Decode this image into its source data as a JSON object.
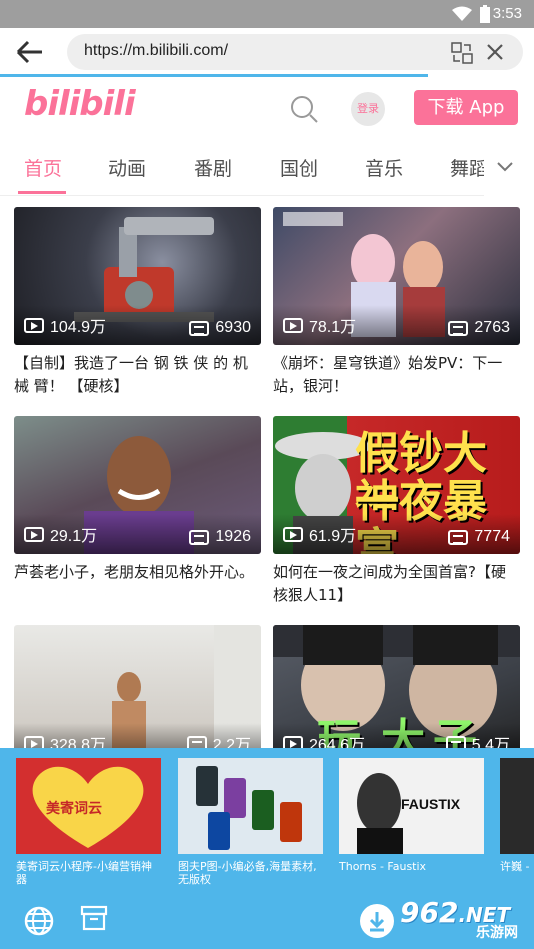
{
  "status": {
    "time": "3:53"
  },
  "browser": {
    "url": "https://m.bilibili.com/"
  },
  "header": {
    "logo": "bilibili",
    "login_label": "登录",
    "download_label": "下载 App"
  },
  "tabs": [
    "首页",
    "动画",
    "番剧",
    "国创",
    "音乐",
    "舞蹈"
  ],
  "videos": [
    {
      "views": "104.9万",
      "danmaku": "6930",
      "title": "【自制】我造了一台 钢 铁 侠 的 机 械 臂！ 【硬核】"
    },
    {
      "views": "78.1万",
      "danmaku": "2763",
      "title": "《崩坏：星穹铁道》始发PV：下一站，银河！"
    },
    {
      "views": "29.1万",
      "danmaku": "1926",
      "title": "芦荟老小子，老朋友相见格外开心。"
    },
    {
      "views": "61.9万",
      "danmaku": "7774",
      "title": "如何在一夜之间成为全国首富?【硬核狠人11】",
      "thumb_text": [
        "假钞大神",
        "一夜暴富"
      ]
    },
    {
      "views": "328.8万",
      "danmaku": "2.2万",
      "title": ""
    },
    {
      "views": "264.6万",
      "danmaku": "5.4万",
      "title": "",
      "thumb_text": [
        "玩",
        "大",
        "子"
      ]
    }
  ],
  "ads": [
    {
      "label": "美寄词云小程序-小编营销神器",
      "img_text": "美寄词云"
    },
    {
      "label": "图夫P图-小编必备,海量素材,无版权"
    },
    {
      "label": "Thorns - Faustix",
      "img_text": "FAUSTIX"
    },
    {
      "label": "许巍 - 曾"
    }
  ],
  "watermark": {
    "number": "962",
    "suffix": ".NET",
    "sub": "乐游网"
  },
  "colors": {
    "brand": "#fb7299",
    "browser_accent": "#4fb6ea"
  }
}
